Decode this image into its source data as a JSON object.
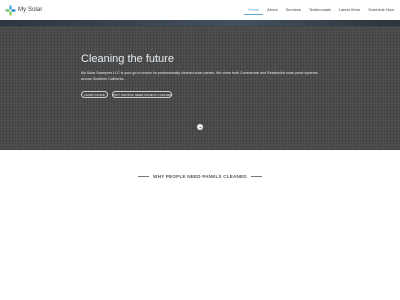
{
  "header": {
    "brand": "My Solar",
    "logo_icon": "leaf-flower-logo-icon",
    "nav": [
      {
        "label": "Home",
        "active": true
      },
      {
        "label": "About",
        "active": false
      },
      {
        "label": "Services",
        "active": false
      },
      {
        "label": "Testimonials",
        "active": false
      },
      {
        "label": "Latest Work",
        "active": false
      },
      {
        "label": "Schedule Now",
        "active": false
      }
    ]
  },
  "hero": {
    "title": "Cleaning the future",
    "description": "My Solar Sweepers LLC is your go-to choice for professionally cleaned solar panels. We clean both Commercial and Residential solar panel systems across Southern California.",
    "buttons": {
      "learn_more": "LEARN MORE",
      "why_clean": "WHY PEOPLE NEED PANELS CLEANED"
    },
    "scroll_icon": "chevron-down-icon"
  },
  "section": {
    "title": "WHY PEOPLE NEED PANELS CLEANED"
  },
  "colors": {
    "accent": "#5fa5d6",
    "hero_bg": "#4f4f4f",
    "title_text": "#555555"
  }
}
